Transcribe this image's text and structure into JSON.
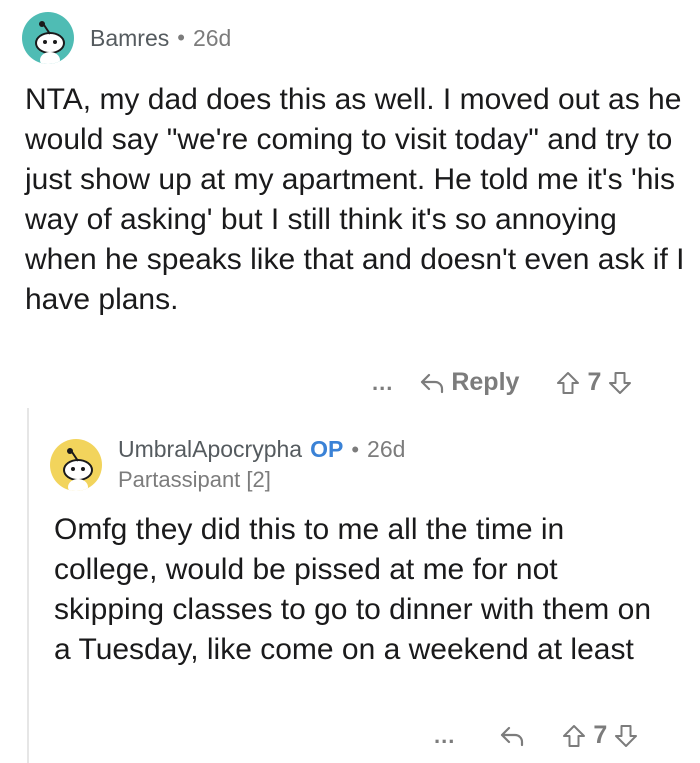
{
  "comments": [
    {
      "username": "Bamres",
      "separator": "•",
      "age": "26d",
      "avatar_color": "#4fbcb4",
      "body": "NTA, my dad does this as well. I moved out as he would say \"we're coming to visit today\" and try to just show up at my apartment. He told me it's 'his way of asking' but I still think it's so annoying when he speaks like that and doesn't even ask if I have plans.",
      "actions": {
        "more": "...",
        "reply_label": "Reply",
        "score": "7"
      }
    },
    {
      "username": "UmbralApocrypha",
      "op_badge": "OP",
      "separator": "•",
      "age": "26d",
      "flair": "Partassipant [2]",
      "avatar_color": "#f2d45c",
      "body": "Omfg they did this to me all the time in college, would be pissed at me for not skipping classes to go to dinner with them on a Tuesday, like come on a weekend at least",
      "actions": {
        "more": "...",
        "score": "7"
      }
    }
  ],
  "icons": [
    "snoo-avatar-icon",
    "reply-arrow-icon",
    "upvote-icon",
    "downvote-icon",
    "more-options-icon"
  ]
}
